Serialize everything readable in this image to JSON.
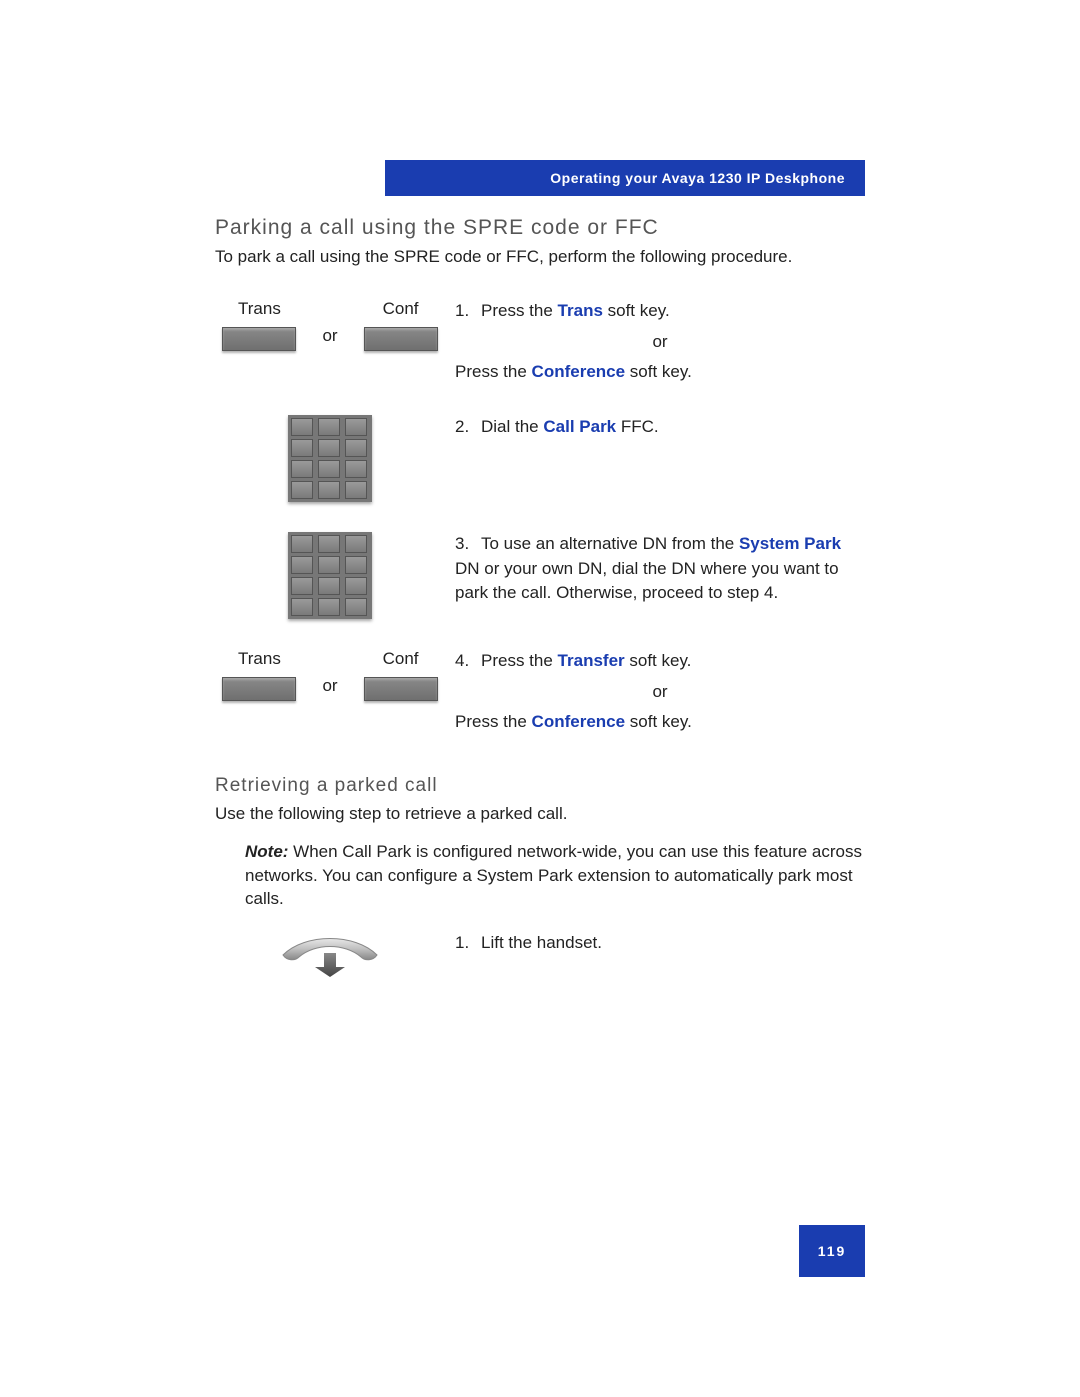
{
  "header": "Operating your Avaya 1230 IP Deskphone",
  "s1": {
    "title": "Parking a call using the SPRE code or FFC",
    "intro": "To park a call using the SPRE code or FFC, perform the following procedure.",
    "softLeft": "Trans",
    "softRight": "Conf",
    "or": "or",
    "st1a": "Press the ",
    "st1key": "Trans",
    "st1b": " soft key.",
    "st1c": "Press the ",
    "st1key2": "Conference",
    "st1d": " soft key.",
    "st2a": "Dial the ",
    "st2key": "Call Park",
    "st2b": " FFC.",
    "st3a": "To use an alternative DN from the ",
    "st3key": "System Park",
    "st3b": " DN or your own DN, dial the DN where you want to park the call. Otherwise, proceed to step 4.",
    "st4a": "Press the ",
    "st4key": "Transfer",
    "st4b": " soft key.",
    "st4c": "Press the ",
    "st4key2": "Conference",
    "st4d": " soft key."
  },
  "s2": {
    "title": "Retrieving a parked call",
    "intro": "Use the following step to retrieve a parked call.",
    "noteLabel": "Note:",
    "note": " When Call Park is configured network-wide, you can use this feature across networks. You can configure a System Park extension to automatically park most calls.",
    "st1": "Lift the handset."
  },
  "pageNumber": "119"
}
